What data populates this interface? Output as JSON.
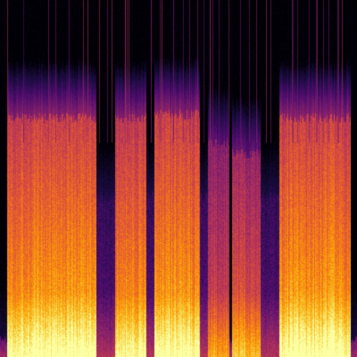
{
  "image": {
    "kind": "spectrogram",
    "colormap": "inferno",
    "background_color": "#000000",
    "palette_stops": [
      "#000004",
      "#1b0c41",
      "#4a0c6b",
      "#781c6d",
      "#a52c60",
      "#cf4446",
      "#ed6925",
      "#fb9b06",
      "#f7d13d",
      "#fcffa4"
    ],
    "active_regions": [
      {
        "name": "segment-1",
        "start_fraction": 0.02,
        "end_fraction": 0.27,
        "level": 0.72,
        "top_fraction": 0.33
      },
      {
        "name": "segment-2",
        "start_fraction": 0.32,
        "end_fraction": 0.41,
        "level": 0.7,
        "top_fraction": 0.33
      },
      {
        "name": "segment-3",
        "start_fraction": 0.43,
        "end_fraction": 0.57,
        "level": 0.72,
        "top_fraction": 0.32
      },
      {
        "name": "segment-4",
        "start_fraction": 0.58,
        "end_fraction": 0.64,
        "level": 0.5,
        "top_fraction": 0.4
      },
      {
        "name": "segment-5",
        "start_fraction": 0.65,
        "end_fraction": 0.73,
        "level": 0.55,
        "top_fraction": 0.43
      },
      {
        "name": "segment-6",
        "start_fraction": 0.78,
        "end_fraction": 0.98,
        "level": 0.72,
        "top_fraction": 0.33
      }
    ],
    "quiet_gaps": [
      {
        "start_fraction": 0.27,
        "end_fraction": 0.32
      },
      {
        "start_fraction": 0.41,
        "end_fraction": 0.43
      },
      {
        "start_fraction": 0.56,
        "end_fraction": 0.58
      },
      {
        "start_fraction": 0.73,
        "end_fraction": 0.78
      }
    ],
    "noise_seed": 1337
  }
}
